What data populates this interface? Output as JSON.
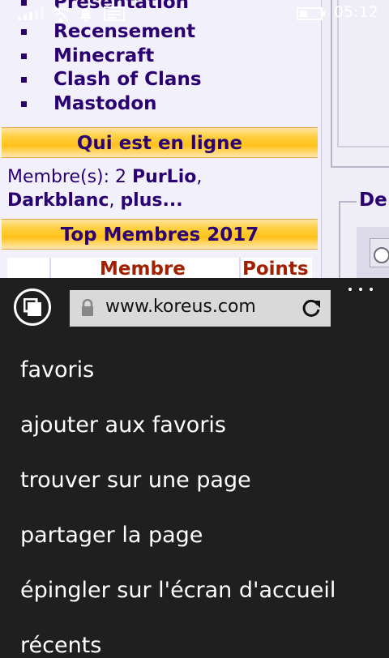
{
  "status_bar": {
    "time": "05:12",
    "icons": [
      "signal-icon",
      "wifi-icon",
      "notification-bell-icon",
      "message-icon",
      "battery-icon"
    ]
  },
  "webpage": {
    "nav_items": [
      "Présentation",
      "Recensement",
      "Minecraft",
      "Clash of Clans",
      "Mastodon"
    ],
    "online_heading": "Qui est en ligne",
    "online_prefix": "Membre(s): 2 ",
    "online_user1": "PurLio",
    "online_sep": ",",
    "online_user2": "Darkblanc",
    "online_sep2": ", ",
    "online_more": "plus...",
    "top_heading": "Top Membres 2017",
    "table_headers": [
      "",
      "Membre",
      "Points"
    ],
    "side_label": "De"
  },
  "browser": {
    "url": "www.koreus.com",
    "more_label": "..."
  },
  "menu": {
    "items": [
      "favoris",
      "ajouter aux favoris",
      "trouver sur une page",
      "partager la page",
      "épingler sur l'écran d'accueil",
      "récents"
    ]
  },
  "colors": {
    "link": "#2a0073",
    "table_header": "#a02000",
    "band": "#ffc21a",
    "appbar": "#1f1f1f",
    "address_bar": "#d9d9d9"
  }
}
